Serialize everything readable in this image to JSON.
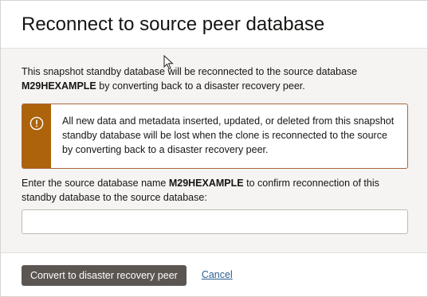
{
  "dialog": {
    "title": "Reconnect to source peer database",
    "intro_prefix": "This snapshot standby database will be reconnected to the source database ",
    "intro_db_name": "M29HEXAMPLE",
    "intro_suffix": " by converting back to a disaster recovery peer.",
    "warning": {
      "icon": "exclamation-circle-icon",
      "text": "All new data and metadata inserted, updated, or deleted from this snapshot standby database will be lost when the clone is reconnected to the source by converting back to a disaster recovery peer.",
      "stripe_color": "#ac630c"
    },
    "confirm": {
      "label_prefix": "Enter the source database name ",
      "label_db_name": "M29HEXAMPLE",
      "label_suffix": " to confirm reconnection of this standby database to the source database:",
      "value": "",
      "placeholder": ""
    },
    "footer": {
      "primary_label": "Convert to disaster recovery peer",
      "cancel_label": "Cancel"
    }
  },
  "colors": {
    "primary_button": "#5b5652",
    "link": "#2b5f8f",
    "warning_border": "#aa643b"
  }
}
